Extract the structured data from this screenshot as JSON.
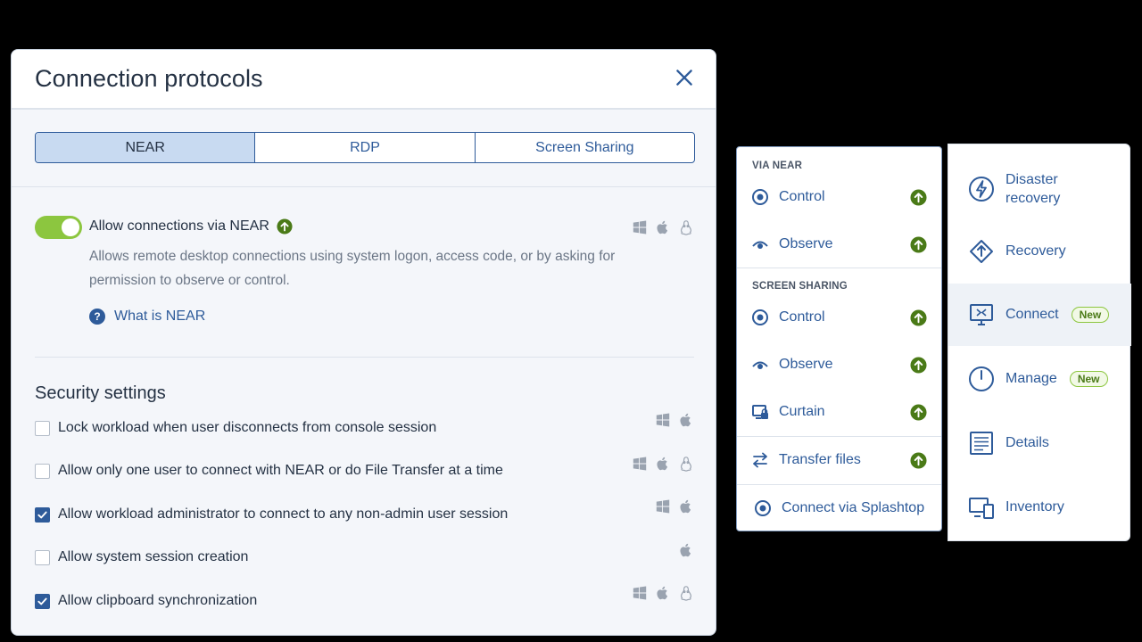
{
  "dialog": {
    "title": "Connection protocols",
    "tabs": [
      {
        "label": "NEAR",
        "active": true
      },
      {
        "label": "RDP",
        "active": false
      },
      {
        "label": "Screen Sharing",
        "active": false
      }
    ],
    "near": {
      "toggle_on": true,
      "label": "Allow connections via NEAR",
      "description": "Allows remote desktop connections using system logon, access code, or by asking for permission to observe or control.",
      "help_link": "What is NEAR",
      "platforms": [
        "windows",
        "mac",
        "linux"
      ]
    },
    "security": {
      "title": "Security settings",
      "items": [
        {
          "label": "Lock workload when user disconnects from console session",
          "checked": false,
          "platforms": [
            "windows",
            "mac"
          ]
        },
        {
          "label": "Allow only one user to connect with NEAR or do File Transfer at a time",
          "checked": false,
          "platforms": [
            "windows",
            "mac",
            "linux"
          ]
        },
        {
          "label": "Allow workload administrator to connect to any non-admin user session",
          "checked": true,
          "platforms": [
            "windows",
            "mac"
          ]
        },
        {
          "label": "Allow system session creation",
          "checked": false,
          "platforms": [
            "mac"
          ]
        },
        {
          "label": "Allow clipboard synchronization",
          "checked": true,
          "platforms": [
            "windows",
            "mac",
            "linux"
          ]
        }
      ]
    }
  },
  "menu": {
    "via_near_header": "VIA NEAR",
    "screen_sharing_header": "SCREEN SHARING",
    "items": [
      {
        "label": "Control",
        "icon": "target-icon"
      },
      {
        "label": "Observe",
        "icon": "eye-icon"
      },
      {
        "label": "Control",
        "icon": "target-icon"
      },
      {
        "label": "Observe",
        "icon": "eye-icon"
      },
      {
        "label": "Curtain",
        "icon": "curtain-lock-icon"
      },
      {
        "label": "Transfer files",
        "icon": "transfer-arrows-icon"
      },
      {
        "label": "Connect via Splashtop",
        "icon": "splashtop-icon"
      }
    ]
  },
  "nav": {
    "items": [
      {
        "label": "Disaster recovery",
        "icon": "lightning-icon"
      },
      {
        "label": "Recovery",
        "icon": "recovery-icon"
      },
      {
        "label": "Connect",
        "icon": "monitor-connect-icon",
        "badge": "New",
        "active": true
      },
      {
        "label": "Manage",
        "icon": "power-icon",
        "badge": "New"
      },
      {
        "label": "Details",
        "icon": "details-icon"
      },
      {
        "label": "Inventory",
        "icon": "inventory-icon"
      }
    ]
  },
  "colors": {
    "accent": "#2e5b9a",
    "toggle_on": "#8cc63f",
    "upgrade_badge": "#4a7a17",
    "tab_active_bg": "#c8daf1"
  }
}
